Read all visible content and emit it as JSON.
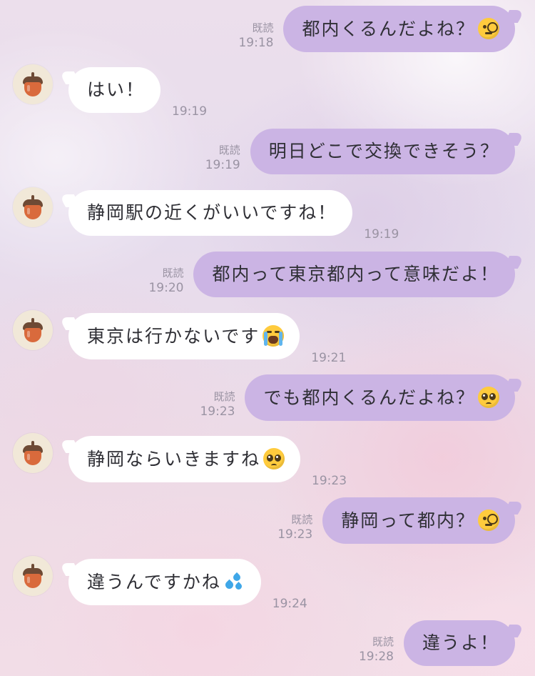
{
  "read_label": "既読",
  "messages": [
    {
      "side": "sent",
      "text": "都内くるんだよね？",
      "emoji": "monocle-face",
      "time": "19:18",
      "read": true
    },
    {
      "side": "recv",
      "text": "はい！",
      "time": "19:19"
    },
    {
      "side": "sent",
      "text": "明日どこで交換できそう？",
      "time": "19:19",
      "read": true
    },
    {
      "side": "recv",
      "text": "静岡駅の近くがいいですね！",
      "time": "19:19"
    },
    {
      "side": "sent",
      "text": "都内って東京都内って意味だよ！",
      "time": "19:20",
      "read": true
    },
    {
      "side": "recv",
      "text": "東京は行かないです",
      "emoji": "loudly-crying-face",
      "time": "19:21"
    },
    {
      "side": "sent",
      "text": "でも都内くるんだよね？",
      "emoji": "pleading-face",
      "time": "19:23",
      "read": true
    },
    {
      "side": "recv",
      "text": "静岡ならいきますね",
      "emoji": "pleading-face",
      "time": "19:23"
    },
    {
      "side": "sent",
      "text": "静岡って都内？",
      "emoji": "monocle-face",
      "time": "19:23",
      "read": true
    },
    {
      "side": "recv",
      "text": "違うんですかね",
      "emoji": "sweat-droplets",
      "time": "19:24"
    },
    {
      "side": "sent",
      "text": "違うよ！",
      "time": "19:28",
      "read": true
    }
  ],
  "avatar": {
    "icon": "acorn-icon"
  }
}
